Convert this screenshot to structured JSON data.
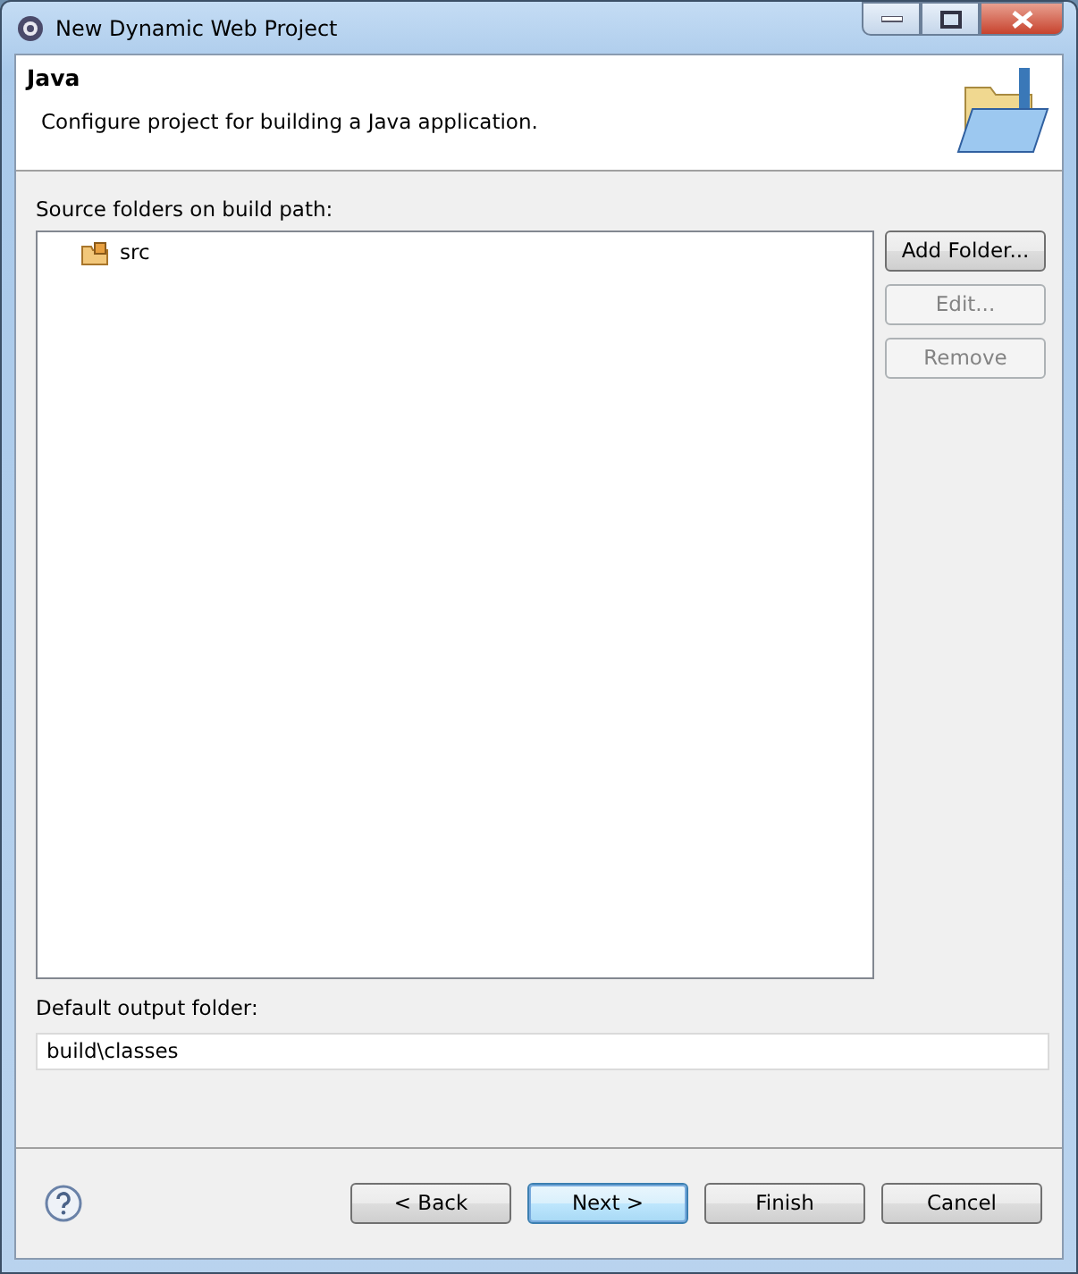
{
  "window": {
    "title": "New Dynamic Web Project"
  },
  "header": {
    "title": "Java",
    "description": "Configure project for building a Java application."
  },
  "source_folders": {
    "label": "Source folders on build path:",
    "items": [
      {
        "label": "src",
        "selected": false
      }
    ],
    "buttons": [
      {
        "label": "Add Folder...",
        "disabled": false
      },
      {
        "label": "Edit...",
        "disabled": true
      },
      {
        "label": "Remove",
        "disabled": true
      }
    ]
  },
  "output_folder": {
    "label": "Default output folder:",
    "value": "build\\classes"
  },
  "footer_buttons": [
    {
      "label": "< Back",
      "default": false,
      "disabled": false
    },
    {
      "label": "Next >",
      "default": true,
      "disabled": false
    },
    {
      "label": "Finish",
      "default": false,
      "disabled": false
    },
    {
      "label": "Cancel",
      "default": false,
      "disabled": false
    }
  ]
}
